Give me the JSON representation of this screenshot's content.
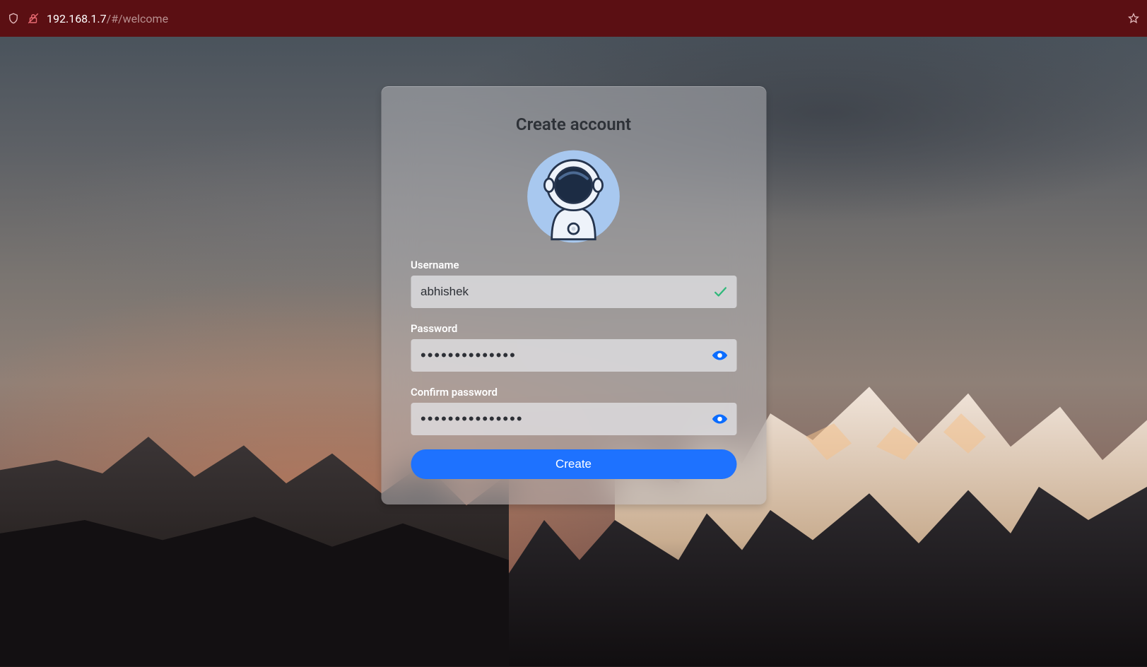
{
  "browser": {
    "url_host": "192.168.1.7",
    "url_path": "/#/welcome"
  },
  "form": {
    "title": "Create account",
    "avatar_name": "astronaut-avatar",
    "username_label": "Username",
    "username_value": "abhishek",
    "password_label": "Password",
    "password_mask": "••••••••••••••",
    "confirm_label": "Confirm password",
    "confirm_mask": "•••••••••••••••",
    "submit_label": "Create"
  },
  "icons": {
    "check": "check-icon",
    "eye": "eye-icon"
  },
  "colors": {
    "accent": "#1e72ff",
    "valid_check": "#2fb87a",
    "eye_icon": "#0a6cff"
  }
}
